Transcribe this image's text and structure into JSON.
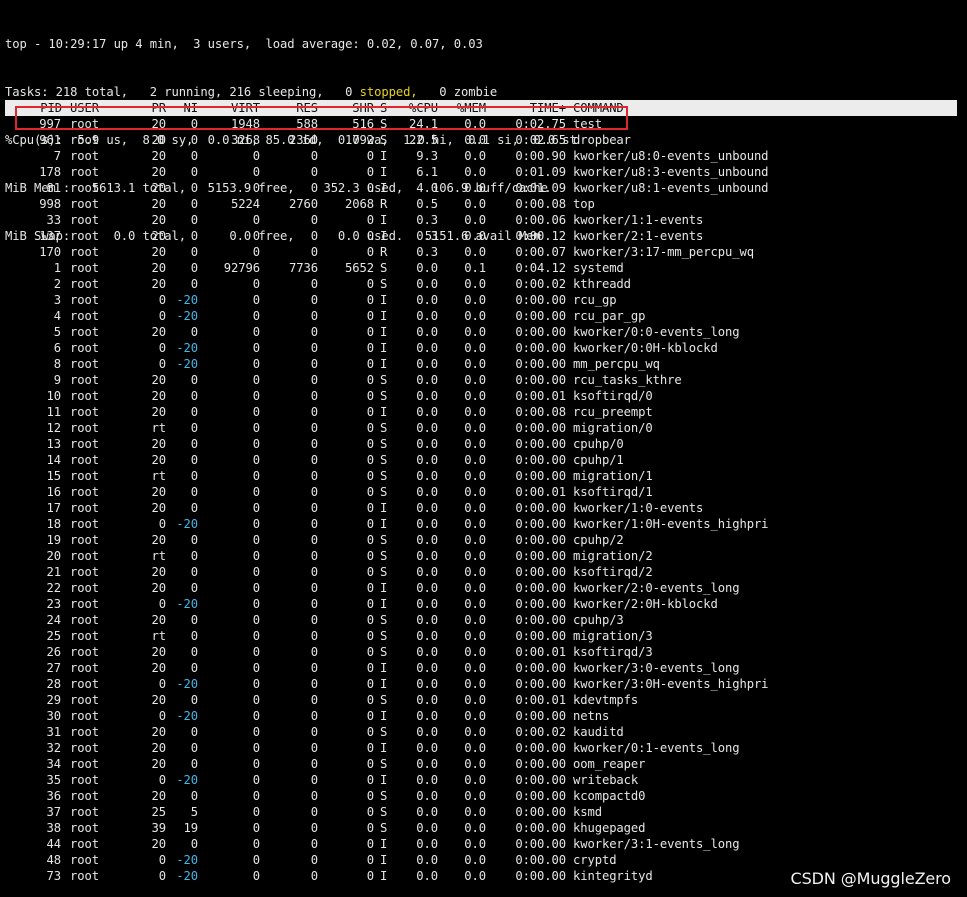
{
  "summary": {
    "line1": "top - 10:29:17 up 4 min,  3 users,  load average: 0.02, 0.07, 0.03",
    "line2_pre": "Tasks: 218 total,   2 running, 216 sleeping,   0 ",
    "line2_stopped": "stopped,",
    "line2_post": "   0 zombie",
    "line3": "%Cpu(s):  5.9 us,  8.0 sy,  0.0 ni, 85.0 id,  0.0 wa,  1.0 hi,  0.1 si,  0.0 st",
    "line4": "MiB Mem :   5613.1 total,   5153.9 free,    352.3 used,    106.9 buff/cache",
    "line5": "MiB Swap:      0.0 total,      0.0 free,      0.0 used.   5151.6 avail Mem"
  },
  "columns": {
    "pid": "PID",
    "user": "USER",
    "pr": "PR",
    "ni": "NI",
    "virt": "VIRT",
    "res": "RES",
    "shr": "SHR",
    "s": "S",
    "cpu": "%CPU",
    "mem": "%MEM",
    "time": "TIME+",
    "command": "COMMAND"
  },
  "processes": [
    [
      "997",
      "root",
      "20",
      "0",
      "1948",
      "588",
      "516",
      "S",
      "24.1",
      "0.0",
      "0:02.75",
      "test"
    ],
    [
      "961",
      "root",
      "20",
      "0",
      "3268",
      "2360",
      "1792",
      "S",
      "22.5",
      "0.0",
      "0:02.65",
      "dropbear"
    ],
    [
      "7",
      "root",
      "20",
      "0",
      "0",
      "0",
      "0",
      "I",
      "9.3",
      "0.0",
      "0:00.90",
      "kworker/u8:0-events_unbound"
    ],
    [
      "178",
      "root",
      "20",
      "0",
      "0",
      "0",
      "0",
      "I",
      "6.1",
      "0.0",
      "0:01.09",
      "kworker/u8:3-events_unbound"
    ],
    [
      "81",
      "root",
      "20",
      "0",
      "0",
      "0",
      "0",
      "I",
      "4.0",
      "0.0",
      "0:01.09",
      "kworker/u8:1-events_unbound"
    ],
    [
      "998",
      "root",
      "20",
      "0",
      "5224",
      "2760",
      "2068",
      "R",
      "0.5",
      "0.0",
      "0:00.08",
      "top"
    ],
    [
      "33",
      "root",
      "20",
      "0",
      "0",
      "0",
      "0",
      "I",
      "0.3",
      "0.0",
      "0:00.06",
      "kworker/1:1-events"
    ],
    [
      "137",
      "root",
      "20",
      "0",
      "0",
      "0",
      "0",
      "I",
      "0.3",
      "0.0",
      "0:00.12",
      "kworker/2:1-events"
    ],
    [
      "170",
      "root",
      "20",
      "0",
      "0",
      "0",
      "0",
      "R",
      "0.3",
      "0.0",
      "0:00.07",
      "kworker/3:17-mm_percpu_wq"
    ],
    [
      "1",
      "root",
      "20",
      "0",
      "92796",
      "7736",
      "5652",
      "S",
      "0.0",
      "0.1",
      "0:04.12",
      "systemd"
    ],
    [
      "2",
      "root",
      "20",
      "0",
      "0",
      "0",
      "0",
      "S",
      "0.0",
      "0.0",
      "0:00.02",
      "kthreadd"
    ],
    [
      "3",
      "root",
      "0",
      "-20",
      "0",
      "0",
      "0",
      "I",
      "0.0",
      "0.0",
      "0:00.00",
      "rcu_gp"
    ],
    [
      "4",
      "root",
      "0",
      "-20",
      "0",
      "0",
      "0",
      "I",
      "0.0",
      "0.0",
      "0:00.00",
      "rcu_par_gp"
    ],
    [
      "5",
      "root",
      "20",
      "0",
      "0",
      "0",
      "0",
      "I",
      "0.0",
      "0.0",
      "0:00.00",
      "kworker/0:0-events_long"
    ],
    [
      "6",
      "root",
      "0",
      "-20",
      "0",
      "0",
      "0",
      "I",
      "0.0",
      "0.0",
      "0:00.00",
      "kworker/0:0H-kblockd"
    ],
    [
      "8",
      "root",
      "0",
      "-20",
      "0",
      "0",
      "0",
      "I",
      "0.0",
      "0.0",
      "0:00.00",
      "mm_percpu_wq"
    ],
    [
      "9",
      "root",
      "20",
      "0",
      "0",
      "0",
      "0",
      "S",
      "0.0",
      "0.0",
      "0:00.00",
      "rcu_tasks_kthre"
    ],
    [
      "10",
      "root",
      "20",
      "0",
      "0",
      "0",
      "0",
      "S",
      "0.0",
      "0.0",
      "0:00.01",
      "ksoftirqd/0"
    ],
    [
      "11",
      "root",
      "20",
      "0",
      "0",
      "0",
      "0",
      "I",
      "0.0",
      "0.0",
      "0:00.08",
      "rcu_preempt"
    ],
    [
      "12",
      "root",
      "rt",
      "0",
      "0",
      "0",
      "0",
      "S",
      "0.0",
      "0.0",
      "0:00.00",
      "migration/0"
    ],
    [
      "13",
      "root",
      "20",
      "0",
      "0",
      "0",
      "0",
      "S",
      "0.0",
      "0.0",
      "0:00.00",
      "cpuhp/0"
    ],
    [
      "14",
      "root",
      "20",
      "0",
      "0",
      "0",
      "0",
      "S",
      "0.0",
      "0.0",
      "0:00.00",
      "cpuhp/1"
    ],
    [
      "15",
      "root",
      "rt",
      "0",
      "0",
      "0",
      "0",
      "S",
      "0.0",
      "0.0",
      "0:00.00",
      "migration/1"
    ],
    [
      "16",
      "root",
      "20",
      "0",
      "0",
      "0",
      "0",
      "S",
      "0.0",
      "0.0",
      "0:00.01",
      "ksoftirqd/1"
    ],
    [
      "17",
      "root",
      "20",
      "0",
      "0",
      "0",
      "0",
      "I",
      "0.0",
      "0.0",
      "0:00.00",
      "kworker/1:0-events"
    ],
    [
      "18",
      "root",
      "0",
      "-20",
      "0",
      "0",
      "0",
      "I",
      "0.0",
      "0.0",
      "0:00.00",
      "kworker/1:0H-events_highpri"
    ],
    [
      "19",
      "root",
      "20",
      "0",
      "0",
      "0",
      "0",
      "S",
      "0.0",
      "0.0",
      "0:00.00",
      "cpuhp/2"
    ],
    [
      "20",
      "root",
      "rt",
      "0",
      "0",
      "0",
      "0",
      "S",
      "0.0",
      "0.0",
      "0:00.00",
      "migration/2"
    ],
    [
      "21",
      "root",
      "20",
      "0",
      "0",
      "0",
      "0",
      "S",
      "0.0",
      "0.0",
      "0:00.00",
      "ksoftirqd/2"
    ],
    [
      "22",
      "root",
      "20",
      "0",
      "0",
      "0",
      "0",
      "I",
      "0.0",
      "0.0",
      "0:00.00",
      "kworker/2:0-events_long"
    ],
    [
      "23",
      "root",
      "0",
      "-20",
      "0",
      "0",
      "0",
      "I",
      "0.0",
      "0.0",
      "0:00.00",
      "kworker/2:0H-kblockd"
    ],
    [
      "24",
      "root",
      "20",
      "0",
      "0",
      "0",
      "0",
      "S",
      "0.0",
      "0.0",
      "0:00.00",
      "cpuhp/3"
    ],
    [
      "25",
      "root",
      "rt",
      "0",
      "0",
      "0",
      "0",
      "S",
      "0.0",
      "0.0",
      "0:00.00",
      "migration/3"
    ],
    [
      "26",
      "root",
      "20",
      "0",
      "0",
      "0",
      "0",
      "S",
      "0.0",
      "0.0",
      "0:00.01",
      "ksoftirqd/3"
    ],
    [
      "27",
      "root",
      "20",
      "0",
      "0",
      "0",
      "0",
      "I",
      "0.0",
      "0.0",
      "0:00.00",
      "kworker/3:0-events_long"
    ],
    [
      "28",
      "root",
      "0",
      "-20",
      "0",
      "0",
      "0",
      "I",
      "0.0",
      "0.0",
      "0:00.00",
      "kworker/3:0H-events_highpri"
    ],
    [
      "29",
      "root",
      "20",
      "0",
      "0",
      "0",
      "0",
      "S",
      "0.0",
      "0.0",
      "0:00.01",
      "kdevtmpfs"
    ],
    [
      "30",
      "root",
      "0",
      "-20",
      "0",
      "0",
      "0",
      "I",
      "0.0",
      "0.0",
      "0:00.00",
      "netns"
    ],
    [
      "31",
      "root",
      "20",
      "0",
      "0",
      "0",
      "0",
      "S",
      "0.0",
      "0.0",
      "0:00.02",
      "kauditd"
    ],
    [
      "32",
      "root",
      "20",
      "0",
      "0",
      "0",
      "0",
      "I",
      "0.0",
      "0.0",
      "0:00.00",
      "kworker/0:1-events_long"
    ],
    [
      "34",
      "root",
      "20",
      "0",
      "0",
      "0",
      "0",
      "S",
      "0.0",
      "0.0",
      "0:00.00",
      "oom_reaper"
    ],
    [
      "35",
      "root",
      "0",
      "-20",
      "0",
      "0",
      "0",
      "I",
      "0.0",
      "0.0",
      "0:00.00",
      "writeback"
    ],
    [
      "36",
      "root",
      "20",
      "0",
      "0",
      "0",
      "0",
      "S",
      "0.0",
      "0.0",
      "0:00.00",
      "kcompactd0"
    ],
    [
      "37",
      "root",
      "25",
      "5",
      "0",
      "0",
      "0",
      "S",
      "0.0",
      "0.0",
      "0:00.00",
      "ksmd"
    ],
    [
      "38",
      "root",
      "39",
      "19",
      "0",
      "0",
      "0",
      "S",
      "0.0",
      "0.0",
      "0:00.00",
      "khugepaged"
    ],
    [
      "44",
      "root",
      "20",
      "0",
      "0",
      "0",
      "0",
      "I",
      "0.0",
      "0.0",
      "0:00.00",
      "kworker/3:1-events_long"
    ],
    [
      "48",
      "root",
      "0",
      "-20",
      "0",
      "0",
      "0",
      "I",
      "0.0",
      "0.0",
      "0:00.00",
      "cryptd"
    ],
    [
      "73",
      "root",
      "0",
      "-20",
      "0",
      "0",
      "0",
      "I",
      "0.0",
      "0.0",
      "0:00.00",
      "kintegrityd"
    ]
  ],
  "colors": {
    "background": "#000000",
    "text": "#e6e6e6",
    "header_bg": "#ececec",
    "stopped": "#e5d11c",
    "negative_nice": "#3fb6e8",
    "highlight_box": "#e0272e"
  },
  "watermark": "CSDN @MuggleZero"
}
